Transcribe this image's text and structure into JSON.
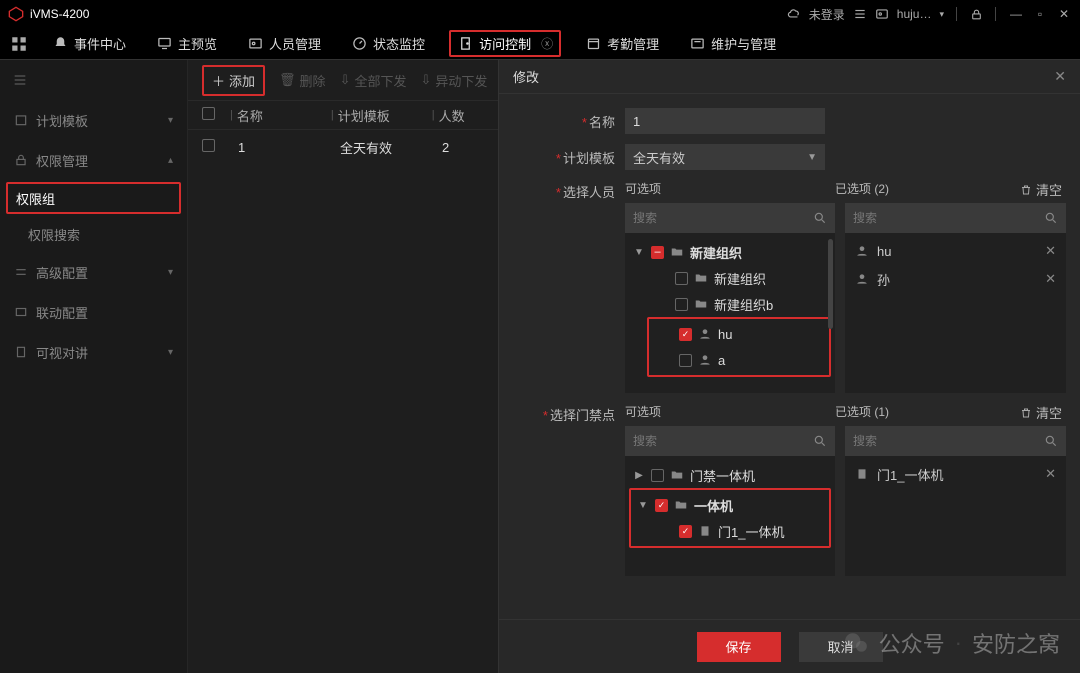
{
  "app": {
    "title": "iVMS-4200"
  },
  "titlebar": {
    "login_state": "未登录",
    "user": "huju…",
    "caret": "▾"
  },
  "nav": {
    "items": [
      {
        "label": "事件中心"
      },
      {
        "label": "主预览"
      },
      {
        "label": "人员管理"
      },
      {
        "label": "状态监控"
      },
      {
        "label": "访问控制"
      },
      {
        "label": "考勤管理"
      },
      {
        "label": "维护与管理"
      }
    ]
  },
  "sidebar": {
    "items": [
      {
        "label": "计划模板"
      },
      {
        "label": "权限管理"
      },
      {
        "label": "权限组"
      },
      {
        "label": "权限搜索"
      },
      {
        "label": "高级配置"
      },
      {
        "label": "联动配置"
      },
      {
        "label": "可视对讲"
      }
    ]
  },
  "toolbar": {
    "add": "添加",
    "delete": "删除",
    "deploy_all": "全部下发",
    "deploy_change": "异动下发"
  },
  "table": {
    "h_name": "名称",
    "h_plan": "计划模板",
    "h_count": "人数",
    "rows": [
      {
        "name": "1",
        "plan": "全天有效",
        "count": "2"
      }
    ]
  },
  "panel": {
    "title": "修改",
    "f_name": "名称",
    "f_name_val": "1",
    "f_plan": "计划模板",
    "f_plan_val": "全天有效",
    "f_persons": "选择人员",
    "f_doors": "选择门禁点",
    "available": "可选项",
    "selected_p": "已选项 (2)",
    "selected_d": "已选项 (1)",
    "clear": "清空",
    "search_ph": "搜索",
    "tree_p": {
      "n0": "新建组织",
      "n1": "新建组织",
      "n2": "新建组织b",
      "n3": "hu",
      "n4": "a"
    },
    "sel_p": {
      "i0": "hu",
      "i1": "孙"
    },
    "tree_d": {
      "n0": "门禁一体机",
      "n1": "一体机",
      "n2": "门1_一体机"
    },
    "sel_d": {
      "i0": "门1_一体机"
    },
    "save": "保存",
    "cancel": "取消"
  },
  "watermark": {
    "text1": "公众号",
    "text2": "安防之窝"
  }
}
